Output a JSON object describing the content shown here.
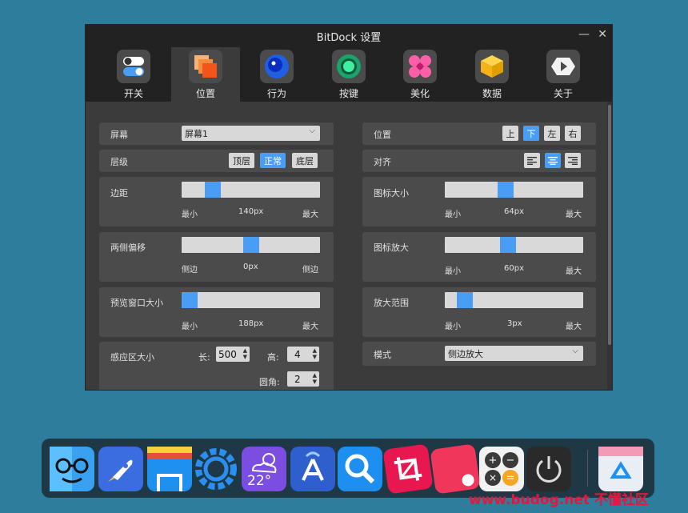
{
  "window": {
    "title": "BitDock 设置",
    "minimize": "—",
    "close": "✕"
  },
  "tabs": [
    {
      "label": "开关",
      "icon": "toggle-icon"
    },
    {
      "label": "位置",
      "icon": "layers-icon"
    },
    {
      "label": "行为",
      "icon": "bubble-icon"
    },
    {
      "label": "按键",
      "icon": "ring-button-icon"
    },
    {
      "label": "美化",
      "icon": "flower-icon"
    },
    {
      "label": "数据",
      "icon": "box-icon"
    },
    {
      "label": "关于",
      "icon": "hexagon-icon"
    }
  ],
  "left": {
    "screen": {
      "label": "屏幕",
      "value": "屏幕1"
    },
    "level": {
      "label": "层级",
      "options": [
        "顶层",
        "正常",
        "底层"
      ],
      "selected": "正常"
    },
    "margin": {
      "label": "边距",
      "min": "最小",
      "value": "140px",
      "max": "最大",
      "fraction": 0.19
    },
    "offset": {
      "label": "两侧偏移",
      "min": "侧边",
      "value": "0px",
      "max": "侧边",
      "fraction": 0.5
    },
    "preview": {
      "label": "预览窗口大小",
      "min": "最小",
      "value": "188px",
      "max": "最大",
      "fraction": 0.0
    },
    "sensing": {
      "label": "感应区大小",
      "long_label": "长:",
      "long_value": "500",
      "high_label": "高:",
      "high_value": "4",
      "radius_label": "圆角:",
      "radius_value": "2"
    }
  },
  "right": {
    "position": {
      "label": "位置",
      "options": [
        "上",
        "下",
        "左",
        "右"
      ],
      "selected": "下"
    },
    "align": {
      "label": "对齐",
      "options": [
        "align-left-icon",
        "align-center-icon",
        "align-right-icon"
      ],
      "selected": "align-center-icon"
    },
    "iconsize": {
      "label": "图标大小",
      "min": "最小",
      "value": "64px",
      "max": "最大",
      "fraction": 0.43
    },
    "iconzoom": {
      "label": "图标放大",
      "min": "最小",
      "value": "60px",
      "max": "最大",
      "fraction": 0.45
    },
    "zoomrange": {
      "label": "放大范围",
      "min": "最小",
      "value": "3px",
      "max": "最大",
      "fraction": 0.1
    },
    "mode": {
      "label": "模式",
      "value": "侧边放大"
    }
  },
  "dock": {
    "items": [
      "finder-face-icon",
      "rocket-icon",
      "files-icon",
      "settings-gear-icon",
      "weather-icon",
      "app-store-icon",
      "search-icon",
      "crop-icon",
      "record-icon",
      "calculator-icon",
      "power-icon",
      "recycle-bin-icon"
    ],
    "weather_temp": "22°"
  },
  "watermark": "www.budog.net 不懂社区",
  "colors": {
    "accent": "#4a9df5",
    "background": "#2f7d9c",
    "window": "#3b3b3b",
    "titlebar": "#222222",
    "panel": "#4b4b4b"
  }
}
